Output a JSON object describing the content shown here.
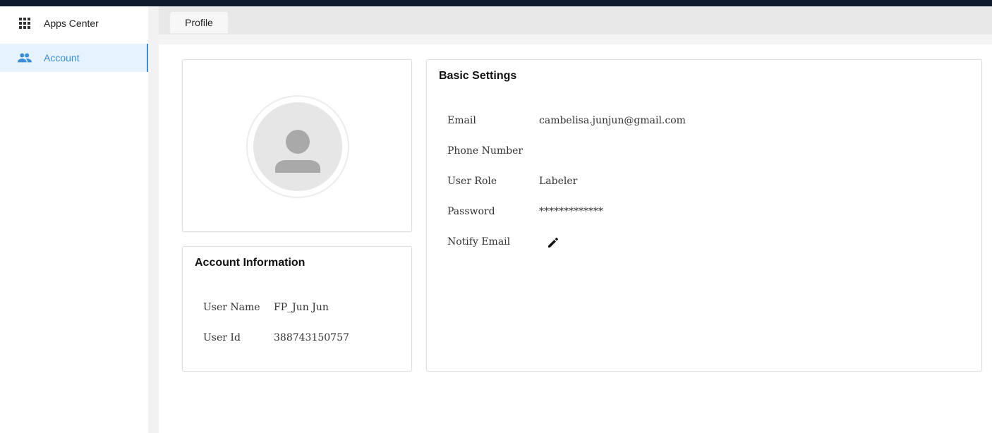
{
  "sidebar": {
    "items": [
      {
        "label": "Apps Center",
        "icon": "apps-grid-icon"
      },
      {
        "label": "Account",
        "icon": "people-icon",
        "active": true
      }
    ]
  },
  "tabs": [
    {
      "label": "Profile",
      "active": true
    }
  ],
  "account_info": {
    "title": "Account Information",
    "fields": [
      {
        "label": "User Name",
        "value": "FP_Jun Jun"
      },
      {
        "label": "User Id",
        "value": "388743150757"
      }
    ]
  },
  "basic_settings": {
    "title": "Basic Settings",
    "fields": [
      {
        "label": "Email",
        "value": "cambelisa.junjun@gmail.com"
      },
      {
        "label": "Phone Number",
        "value": ""
      },
      {
        "label": "User Role",
        "value": "Labeler"
      },
      {
        "label": "Password",
        "value": "*************"
      },
      {
        "label": "Notify Email",
        "value": ""
      }
    ]
  },
  "colors": {
    "accent": "#3a8fd8",
    "topbar": "#0f1b2d",
    "active_bg": "#e6f2fc"
  }
}
